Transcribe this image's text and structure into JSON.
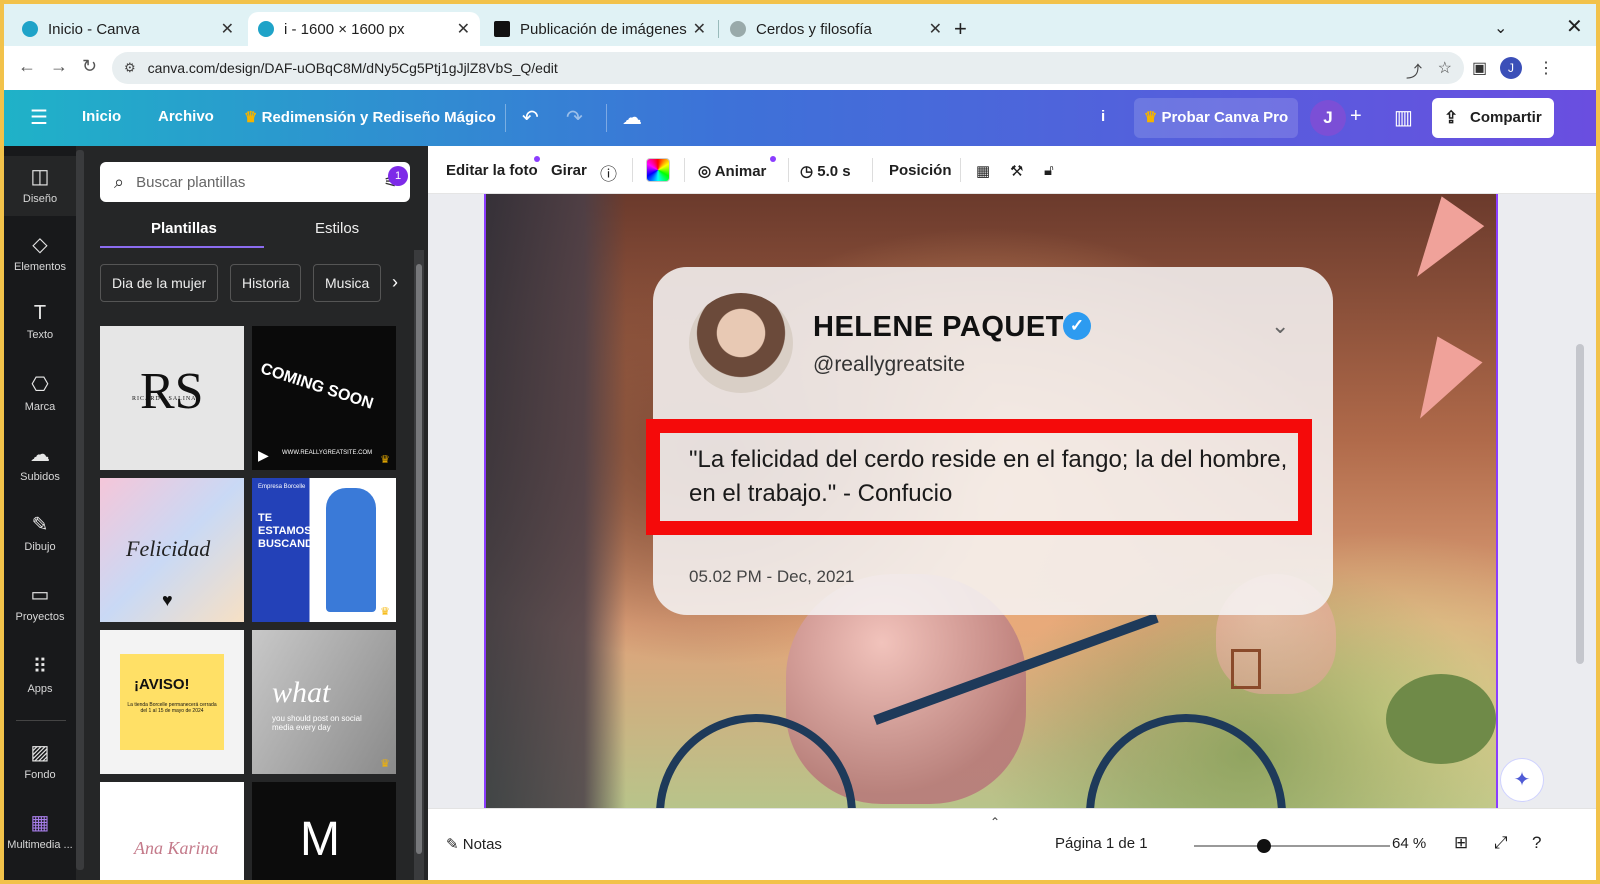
{
  "browser": {
    "tabs": [
      {
        "label": "Inicio - Canva",
        "active": false
      },
      {
        "label": "i - 1600 × 1600 px",
        "active": true
      },
      {
        "label": "Publicación de imágenes",
        "active": false
      },
      {
        "label": "Cerdos y filosofía",
        "active": false
      }
    ],
    "url": "canva.com/design/DAF-uOBqC8M/dNy5Cg5Ptj1gJjlZ8VbS_Q/edit",
    "profile_initial": "J"
  },
  "header": {
    "menu_icon": "hamburger-icon",
    "inicio": "Inicio",
    "archivo": "Archivo",
    "magic": "Redimensión y Rediseño Mágico",
    "design_title": "i",
    "pro": "Probar Canva Pro",
    "avatar": "J",
    "share": "Compartir"
  },
  "rail": [
    {
      "label": "Diseño",
      "icon": "design-icon"
    },
    {
      "label": "Elementos",
      "icon": "elements-icon"
    },
    {
      "label": "Texto",
      "icon": "text-icon"
    },
    {
      "label": "Marca",
      "icon": "brand-icon"
    },
    {
      "label": "Subidos",
      "icon": "upload-icon"
    },
    {
      "label": "Dibujo",
      "icon": "draw-icon"
    },
    {
      "label": "Proyectos",
      "icon": "folder-icon"
    },
    {
      "label": "Apps",
      "icon": "apps-icon"
    },
    {
      "label": "Fondo",
      "icon": "background-icon"
    },
    {
      "label": "Multimedia ...",
      "icon": "multimedia-icon"
    }
  ],
  "panel": {
    "search_placeholder": "Buscar plantillas",
    "filter_badge": "1",
    "tabs": [
      "Plantillas",
      "Estilos"
    ],
    "chips": [
      "Dia de la mujer",
      "Historia",
      "Musica"
    ],
    "templates": [
      {
        "text": "RS",
        "sub": "RICARDO SALINAS"
      },
      {
        "text": "COMING SOON",
        "sub": "WWW.REALLYGREATSITE.COM"
      },
      {
        "text": "Felicidad"
      },
      {
        "text": "TE ESTAMOS BUSCANDO",
        "sub": "Empresa Borcelle"
      },
      {
        "text": "¡AVISO!",
        "sub": "La tienda Borcelle permanecerá cerrada del 1 al 15 de mayo de 2024"
      },
      {
        "text": "what",
        "sub": "you should post on social media every day"
      },
      {
        "text": "Ana Karina"
      },
      {
        "text": "M"
      }
    ]
  },
  "context_toolbar": {
    "edit_photo": "Editar la foto",
    "rotate": "Girar",
    "animate": "Animar",
    "duration": "5.0 s",
    "position": "Posición"
  },
  "card": {
    "name": "HELENE PAQUET",
    "handle": "@reallygreatsite",
    "quote": "\"La felicidad del cerdo reside en el fango; la del hombre, en el trabajo.\" - Confucio",
    "date": "05.02 PM - Dec, 2021"
  },
  "bottom": {
    "notes": "Notas",
    "page": "Página 1 de 1",
    "zoom": "64 %",
    "zoom_level": 0.32
  },
  "colors": {
    "accent": "#8b3dff",
    "highlight_box": "#f50a0a",
    "verified": "#2d9bf0"
  }
}
